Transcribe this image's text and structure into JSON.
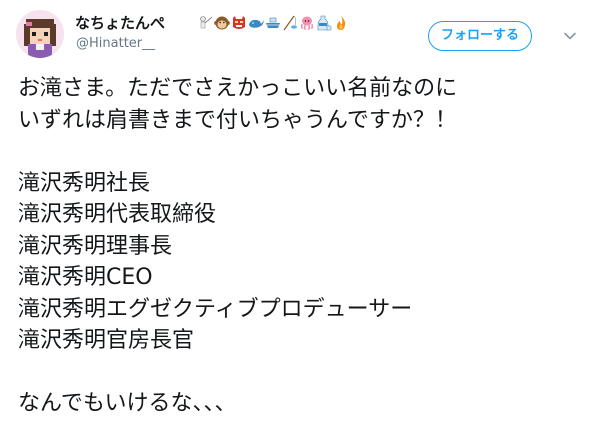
{
  "tweet": {
    "author": {
      "display_name": "なちょたんぺ",
      "handle": "@Hinatter__",
      "emojis": [
        "fencer-icon",
        "monkey-face-icon",
        "oni-mask-icon",
        "whale-icon",
        "ship-icon",
        "fishing-pole-icon",
        "octopus-icon",
        "sake-icon",
        "fire-icon"
      ]
    },
    "follow_label": "フォローする",
    "menu_icon": "chevron-down-icon",
    "lines": [
      "お滝さま。ただでさえかっこいい名前なのに",
      "いずれは肩書きまで付いちゃうんですか？！",
      "",
      "滝沢秀明社長",
      "滝沢秀明代表取締役",
      "滝沢秀明理事長",
      "滝沢秀明CEO",
      "滝沢秀明エグゼクティブプロデューサー",
      "滝沢秀明官房長官",
      "",
      "なんでもいけるな、、、"
    ],
    "colors": {
      "accent": "#1da1f2",
      "secondary_text": "#657786",
      "primary_text": "#14171a"
    }
  }
}
